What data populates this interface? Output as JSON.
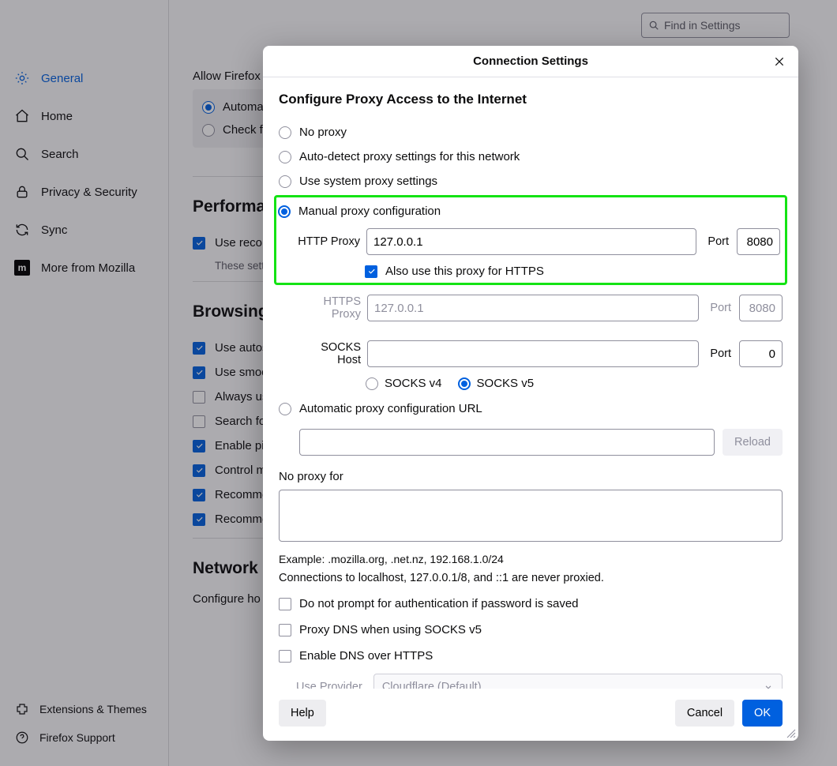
{
  "search": {
    "placeholder": "Find in Settings"
  },
  "sidebar": {
    "items": [
      {
        "label": "General"
      },
      {
        "label": "Home"
      },
      {
        "label": "Search"
      },
      {
        "label": "Privacy & Security"
      },
      {
        "label": "Sync"
      },
      {
        "label": "More from Mozilla"
      }
    ],
    "footer": [
      {
        "label": "Extensions & Themes"
      },
      {
        "label": "Firefox Support"
      }
    ]
  },
  "main": {
    "allow_label": "Allow Firefox",
    "auto_label": "Automat",
    "check_label": "Check fo",
    "perf_heading": "Performan",
    "use_recon": "Use recon",
    "settings_note": "These setti",
    "browsing_heading": "Browsing",
    "items": [
      "Use autos",
      "Use smoo",
      "Always us",
      "Search for",
      "Enable pic",
      "Control m",
      "Recomme",
      "Recomme"
    ],
    "network_heading": "Network S",
    "configure": "Configure ho"
  },
  "dialog": {
    "title": "Connection Settings",
    "heading": "Configure Proxy Access to the Internet",
    "radios": {
      "no_proxy": "No proxy",
      "auto_detect": "Auto-detect proxy settings for this network",
      "system": "Use system proxy settings",
      "manual": "Manual proxy configuration",
      "pac": "Automatic proxy configuration URL"
    },
    "http_label": "HTTP Proxy",
    "http_value": "127.0.0.1",
    "http_port": "8080",
    "port_label": "Port",
    "also_https": "Also use this proxy for HTTPS",
    "https_label": "HTTPS Proxy",
    "https_value": "127.0.0.1",
    "https_port": "8080",
    "socks_label": "SOCKS Host",
    "socks_value": "",
    "socks_port": "0",
    "socks_v4": "SOCKS v4",
    "socks_v5": "SOCKS v5",
    "reload": "Reload",
    "no_proxy_for": "No proxy for",
    "example": "Example: .mozilla.org, .net.nz, 192.168.1.0/24",
    "note": "Connections to localhost, 127.0.0.1/8, and ::1 are never proxied.",
    "checks": {
      "no_prompt": "Do not prompt for authentication if password is saved",
      "proxy_dns": "Proxy DNS when using SOCKS v5",
      "doh": "Enable DNS over HTTPS"
    },
    "provider_label": "Use Provider",
    "provider_value": "Cloudflare (Default)",
    "help": "Help",
    "cancel": "Cancel",
    "ok": "OK"
  }
}
